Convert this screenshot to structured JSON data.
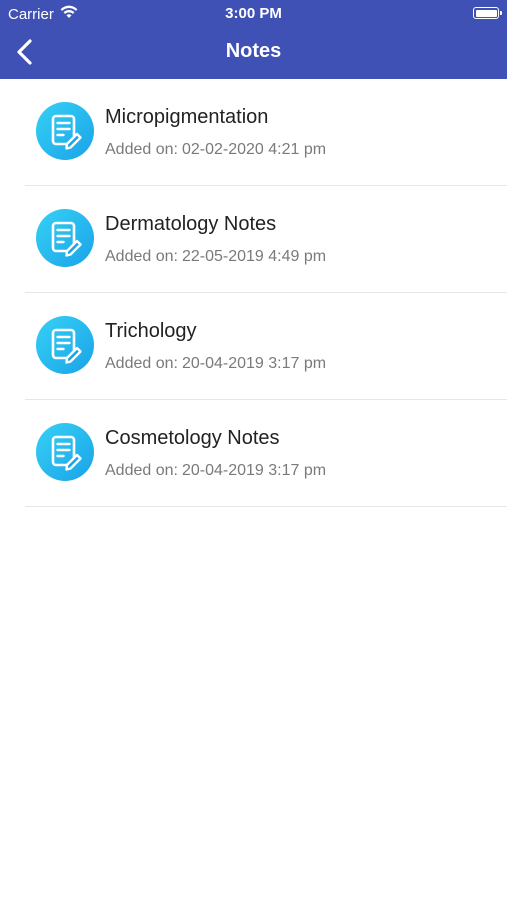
{
  "status_bar": {
    "carrier": "Carrier",
    "time": "3:00 PM"
  },
  "nav": {
    "title": "Notes",
    "back_icon": "chevron-left-icon"
  },
  "colors": {
    "header_bg": "#3f51b5",
    "icon_gradient_start": "#36d1f5",
    "icon_gradient_end": "#1aa3e8"
  },
  "notes": {
    "date_prefix": "Added on:",
    "items": [
      {
        "title": "Micropigmentation",
        "date": "02-02-2020 4:21 pm",
        "icon": "note-edit-icon"
      },
      {
        "title": "Dermatology Notes",
        "date": "22-05-2019 4:49 pm",
        "icon": "note-edit-icon"
      },
      {
        "title": "Trichology",
        "date": "20-04-2019 3:17 pm",
        "icon": "note-edit-icon"
      },
      {
        "title": "Cosmetology Notes",
        "date": "20-04-2019 3:17 pm",
        "icon": "note-edit-icon"
      }
    ]
  }
}
